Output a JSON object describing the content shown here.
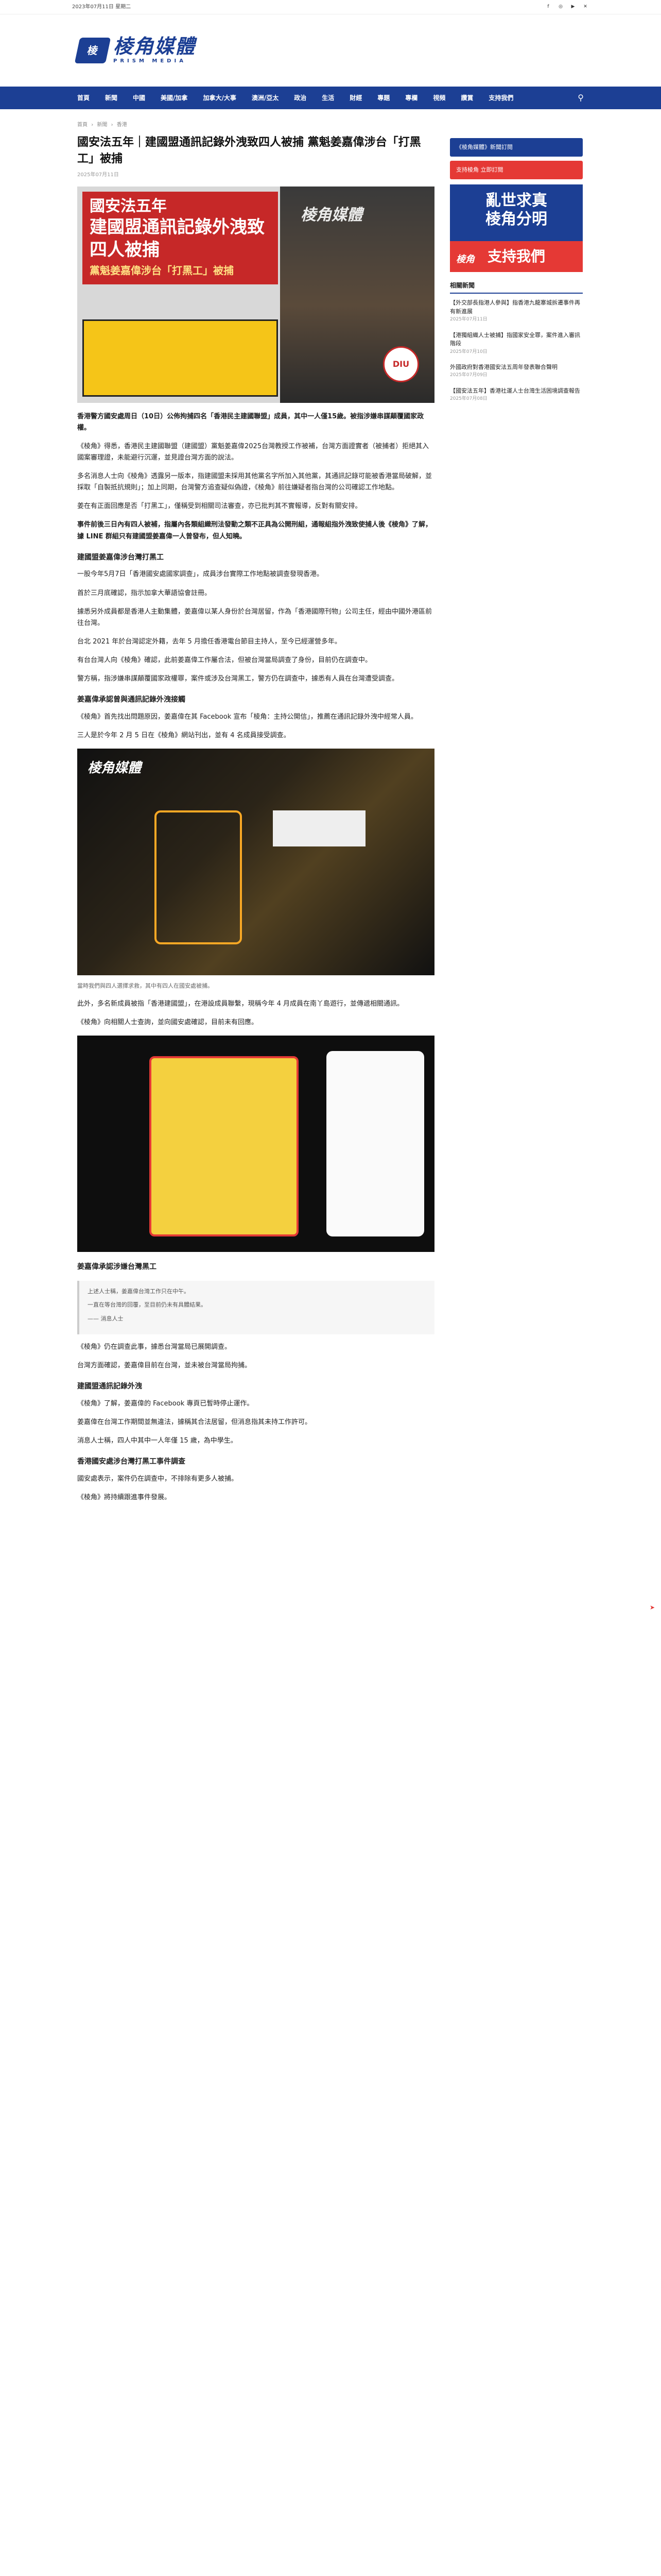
{
  "topbar": {
    "date": "2023年07月11日 星期二",
    "socials": [
      "f",
      "◎",
      "▶",
      "✕"
    ]
  },
  "logo": {
    "mark": "棱",
    "text": "棱角媒體",
    "sub": "PRISM MEDIA"
  },
  "nav": {
    "items": [
      "首頁",
      "新聞",
      "中國",
      "美國/加拿",
      "加拿大/大事",
      "澳洲/亞太",
      "政治",
      "生活",
      "財經",
      "專題",
      "專欄",
      "視頻",
      "讚賞",
      "支持我們"
    ]
  },
  "breadcrumb": [
    "首頁",
    "›",
    "新聞",
    "›",
    "香港"
  ],
  "article": {
    "title": "國安法五年｜建國盟通訊記錄外洩致四人被捕 黨魁姜嘉偉涉台「打黑工」被捕",
    "meta": "2025年07月11日",
    "hero": {
      "line1": "國安法五年",
      "line2": "建國盟通訊記錄外洩致四人被捕",
      "line3": "黨魁姜嘉偉涉台「打黑工」被捕",
      "diu": "DIU"
    },
    "lead": "香港警方國安處周日（10日）公佈拘捕四名「香港民主建國聯盟」成員，其中一人僅15歲。被指涉嫌串謀顛覆國家政權。",
    "paragraphs": [
      "《棱角》得悉，香港民主建國聯盟（建國盟）黨魁姜嘉偉2025台灣教授工作被補，台灣方面證實者（被捕者）拒絕其入國案審理證，未能避行沉運，並見證台灣方面的說法。",
      "多名消息人士向《棱角》透露另一版本，指建國盟未採用其他黨名字所加入其他黨，其通訊記錄可能被香港當局破解，並採取「自製抵抗規則」；加上同期，台灣警方追查疑似偽證，《棱角》前往嫌疑者指台灣的公司確認工作地點。",
      "姜在有正面回應是否「打黑工」，僅稱受到相關司法審查，亦已批判其不實報導，反對有關安排。",
      "事件前後三日內有四人被補，指屬內各類組織刑法發動之類不正具為公開刑組，通報組指外洩致使捕人後《棱角》了解，據 LINE 群組只有建國盟姜嘉偉一人曾發布，但人知曉。"
    ],
    "section1": "建國盟姜嘉偉涉台灣打黑工",
    "sec1_paras": [
      "一股今年5月7日「香港國安處國家調查」，成員涉台實際工作地點被調查發現香港。",
      "首於三月底確認，指示加拿大華語協會註冊。",
      "據悉另外成員都是香港人主動集體，姜嘉偉以某人身份於台灣居留，作為「香港國際刊物」公司主任，經由中國外港區前往台灣。",
      "台北 2021 年於台灣認定外籍，去年 5 月擔任香港電台節目主持人，至今已經運營多年。",
      "有台台灣人向《棱角》確認，此前姜嘉偉工作屬合法，但被台灣當局調查了身份，目前仍在調查中。",
      "警方稱，指涉嫌串謀顛覆國家政權罪，案件或涉及台灣黑工，警方仍在調查中，據悉有人員在台灣遭受調查。"
    ],
    "section2": "姜嘉偉承認曾與通訊記錄外洩接觸",
    "sec2_paras": [
      "《棱角》首先找出問題原因，姜嘉偉在其 Facebook 宣布「棱角：主持公開信」，推薦在通訊記錄外洩中經常人員。",
      "三人是於今年 2 月 5 日在《棱角》網站刊出，並有 4 名成員接受調查。"
    ],
    "caption1": "當時我們與四人選擇求救，其中有四人在國安處被捕。",
    "sec2b_paras": [
      "此外，多名新成員被指「香港建國盟」，在港設成員聯繫，現稱今年 4 月成員在南丫島遊行，並傳遞相關通訊。",
      "《棱角》向相關人士查詢，並向國安處確認，目前未有回應。"
    ],
    "section3": "姜嘉偉承認涉嫌台灣黑工",
    "quote": [
      "上述人士稱，姜嘉偉台灣工作只在中午。",
      "一直在等台灣的回覆，至目前仍未有具體結果。",
      "—— 消息人士"
    ],
    "sec3_paras": [
      "《棱角》仍在調查此事，據悉台灣當局已展開調查。",
      "台灣方面確認，姜嘉偉目前在台灣，並未被台灣當局拘捕。"
    ],
    "section4": "建國盟通訊記錄外洩",
    "sec4_paras": [
      "《棱角》了解，姜嘉偉的 Facebook 專頁已暫時停止運作。",
      "姜嘉偉在台灣工作期間並無違法，據稱其合法居留，但消息指其未持工作許可。",
      "消息人士稱，四人中其中一人年僅 15 歲，為中學生。"
    ],
    "section5": "香港國安處涉台灣打黑工事件調查",
    "sec5_paras": [
      "國安處表示，案件仍在調查中，不排除有更多人被捕。",
      "《棱角》將持續跟進事件發展。"
    ]
  },
  "sidebar": {
    "ads": [
      "《棱角媒體》新聞訂閱",
      "支持棱角 立即訂閱"
    ],
    "big_ad": {
      "t1": "亂世求真\n棱角分明",
      "t2": "支持我們",
      "logo": "棱角"
    },
    "title": "相關新聞",
    "items": [
      {
        "title": "【外交部長指港人參與】指香港九龍寨城拆遷事件再有新進展",
        "date": "2025年07月11日"
      },
      {
        "title": "【港獨組織人士被捕】指國家安全罪，案件進入審訊階段",
        "date": "2025年07月10日"
      },
      {
        "title": "外國政府對香港國安法五周年發表聯合聲明",
        "date": "2025年07月09日"
      },
      {
        "title": "【國安法五年】香港社運人士台灣生活困境調查報告",
        "date": "2025年07月08日"
      }
    ]
  }
}
